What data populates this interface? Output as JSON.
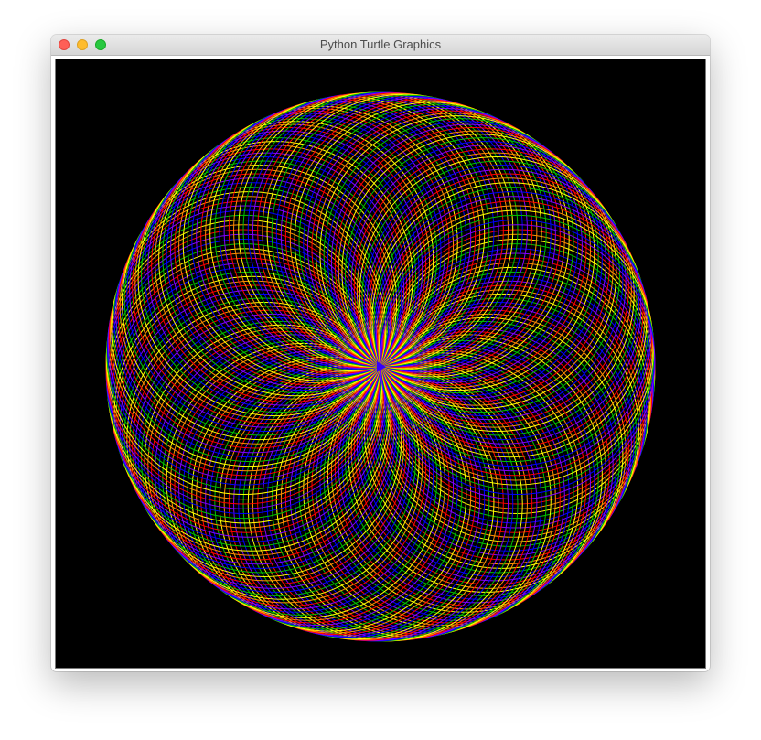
{
  "window": {
    "title": "Python Turtle Graphics"
  },
  "controls": {
    "close_icon": "close-icon",
    "minimize_icon": "minimize-icon",
    "zoom_icon": "zoom-icon"
  },
  "colors": {
    "close": "#fe5f57",
    "minimize": "#febc2e",
    "zoom": "#28c840",
    "canvas_background": "#000000"
  },
  "drawing": {
    "pen_colors": [
      "#ff0000",
      "#ff8c00",
      "#ffff00",
      "#00c000",
      "#0000ff",
      "#8000ff"
    ],
    "circle_count": 180,
    "turtle_color": "#3300ff"
  }
}
